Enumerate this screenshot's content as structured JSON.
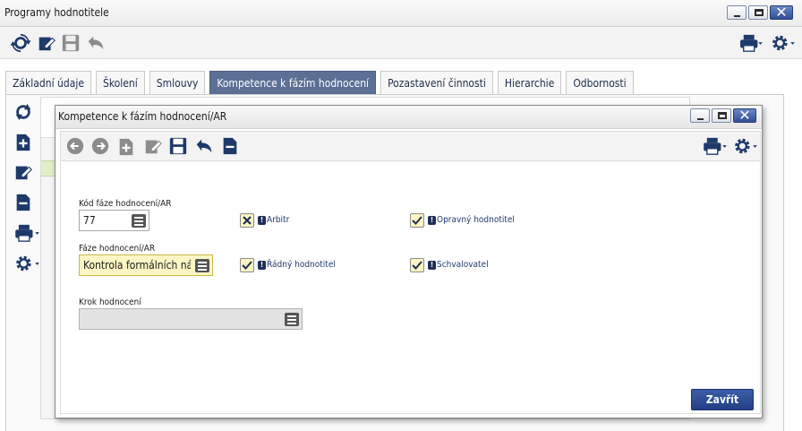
{
  "window": {
    "title": "Programy hodnotitele"
  },
  "main_toolbar": {
    "icons": [
      "refresh-icon",
      "edit-icon",
      "save-icon",
      "undo-icon",
      "print-icon",
      "settings-icon"
    ]
  },
  "tabs": [
    {
      "label": "Základní údaje",
      "active": false
    },
    {
      "label": "Školení",
      "active": false
    },
    {
      "label": "Smlouvy",
      "active": false
    },
    {
      "label": "Kompetence k fázím hodnocení",
      "active": true
    },
    {
      "label": "Pozastavení činnosti",
      "active": false
    },
    {
      "label": "Hierarchie",
      "active": false
    },
    {
      "label": "Odbornosti",
      "active": false
    }
  ],
  "side_toolbar": {
    "icons": [
      "refresh-icon",
      "add-icon",
      "edit-icon",
      "delete-icon",
      "print-icon",
      "settings-icon"
    ]
  },
  "dialog": {
    "title": "Kompetence k fázím hodnocení/AR",
    "toolbar_icons": [
      "back-icon",
      "forward-icon",
      "add-icon",
      "edit-icon",
      "save-icon",
      "undo-icon",
      "delete-icon",
      "print-icon",
      "settings-icon"
    ],
    "fields": {
      "kod_faze": {
        "label": "Kód fáze hodnocení/AR",
        "value": "77"
      },
      "faze": {
        "label": "Fáze hodnocení/AR",
        "value": "Kontrola formálních nál"
      },
      "krok": {
        "label": "Krok hodnocení",
        "value": ""
      }
    },
    "checkboxes": {
      "arbitr": {
        "label": "Arbitr",
        "state": "x"
      },
      "opravny": {
        "label": "Opravný hodnotitel",
        "state": "checked"
      },
      "radny": {
        "label": "Řádný hodnotitel",
        "state": "checked"
      },
      "schvalovatel": {
        "label": "Schvalovatel",
        "state": "checked"
      }
    },
    "mandatory_marker": "!",
    "close_label": "Zavřít"
  },
  "colors": {
    "accent": "#5c6f94",
    "button": "#233f85",
    "icon": "#1e3a6b",
    "mandatory_bg": "#fdf6c4"
  }
}
